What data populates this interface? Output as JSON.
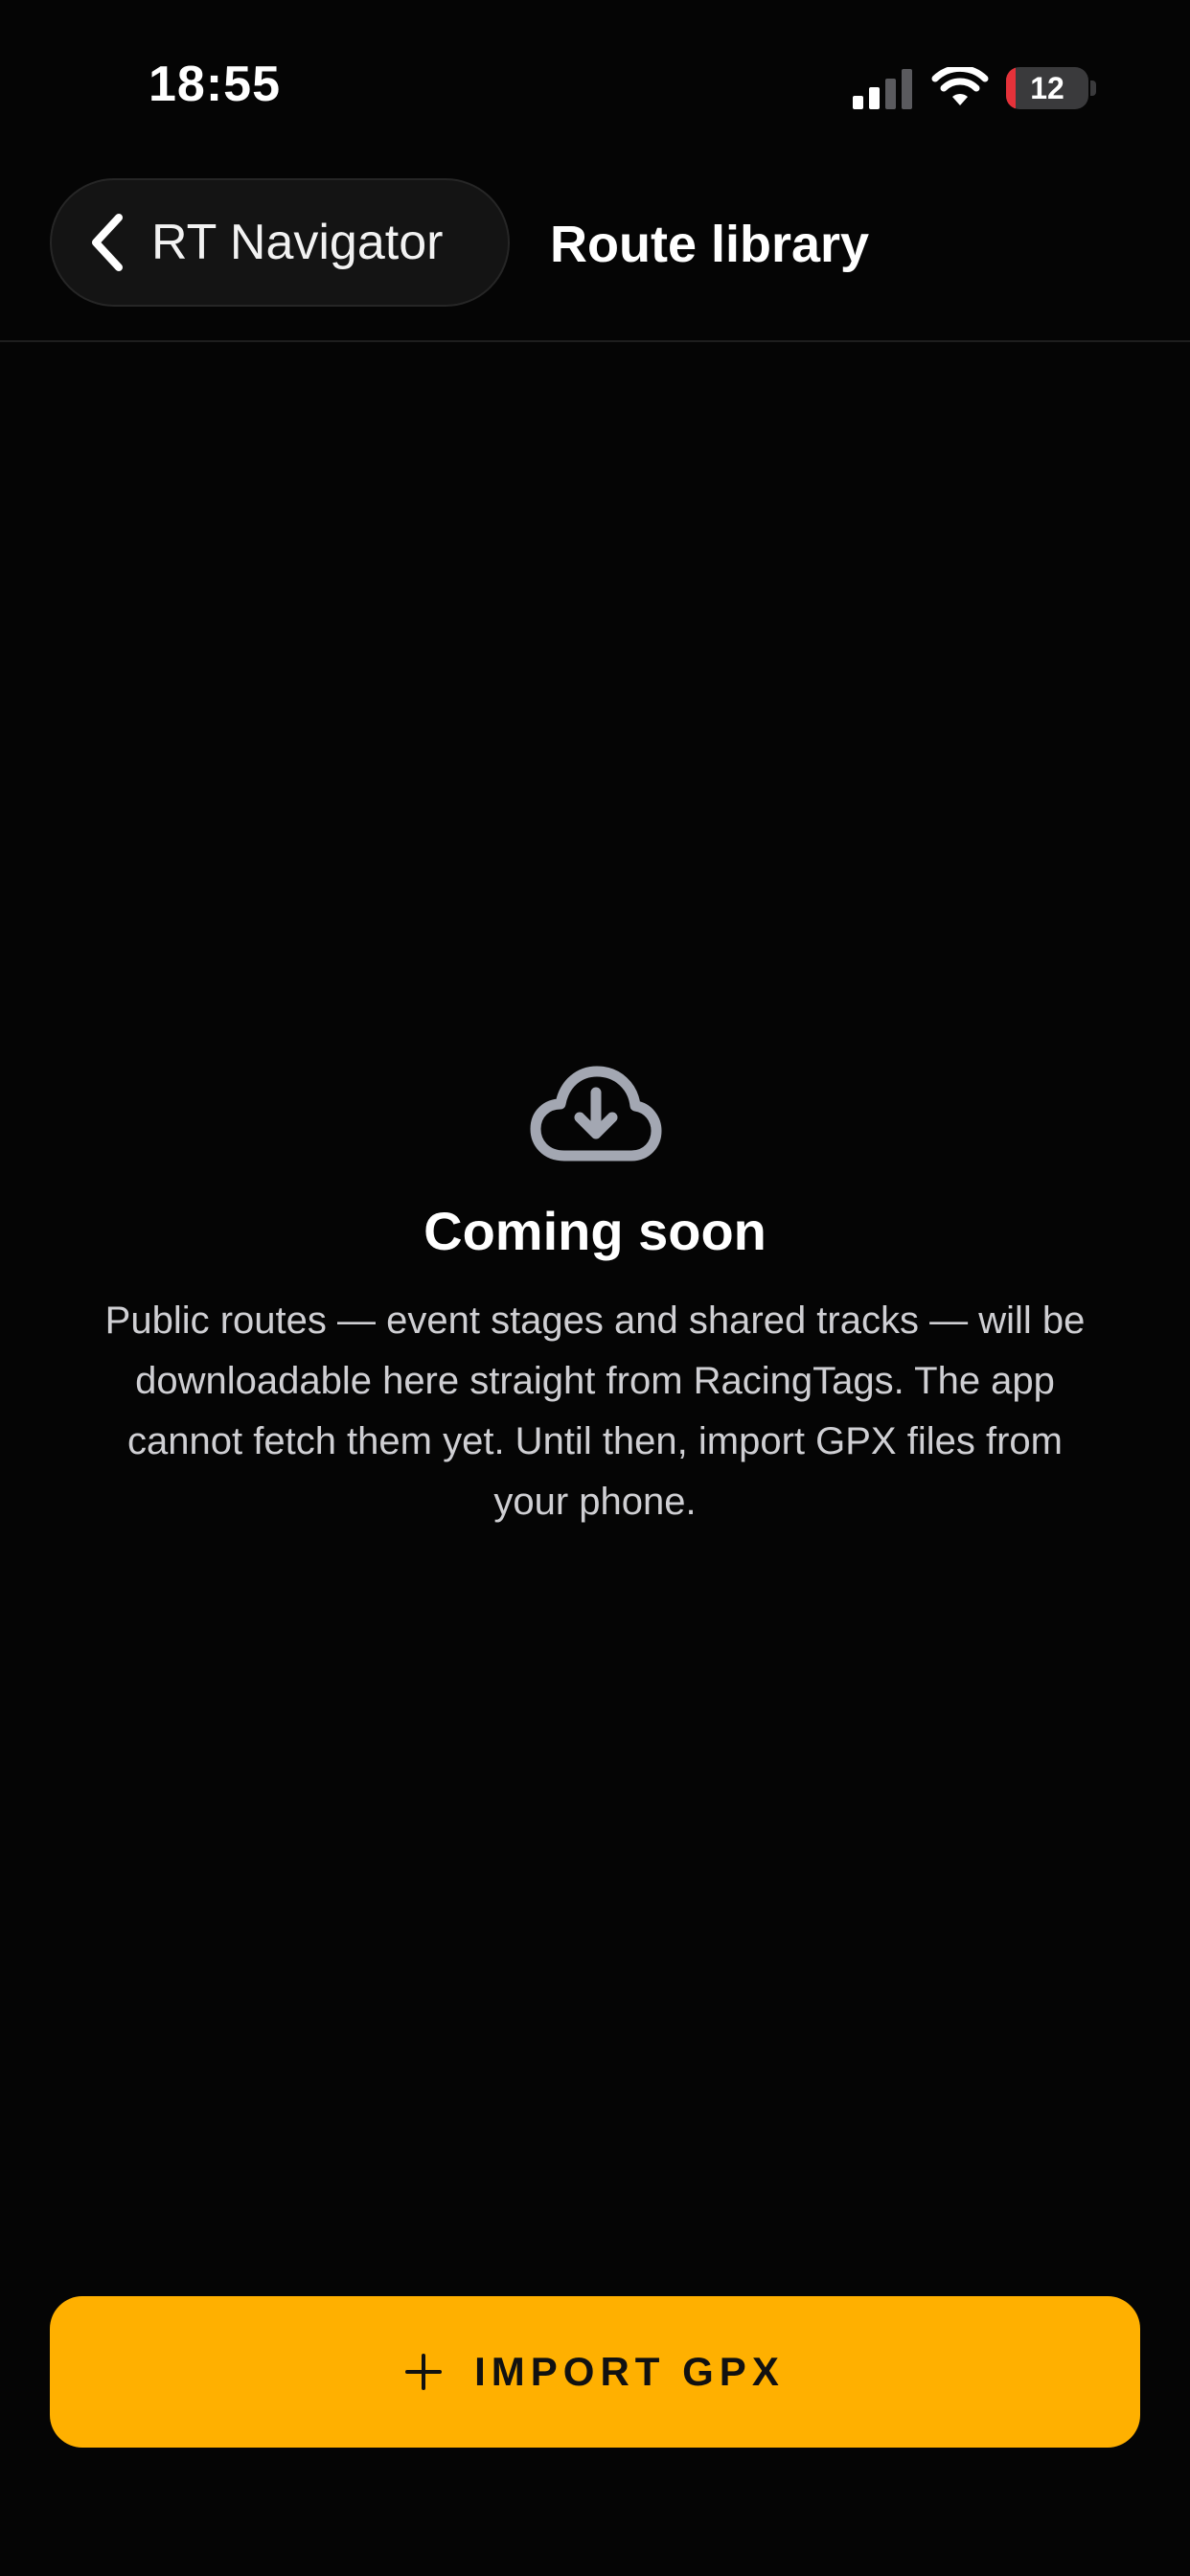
{
  "status_bar": {
    "time": "18:55",
    "battery_level": "12",
    "battery_fraction": 0.12
  },
  "nav": {
    "back_label": "RT Navigator",
    "title": "Route library"
  },
  "empty_state": {
    "icon": "cloud-download-icon",
    "title": "Coming soon",
    "description": "Public routes — event stages and shared tracks — will be downloadable here straight from RacingTags. The app cannot fetch them yet. Until then, import GPX files from your phone."
  },
  "import_button": {
    "label": "IMPORT GPX",
    "icon": "plus-icon"
  },
  "colors": {
    "background": "#050505",
    "accent": "#ffb000",
    "battery_low": "#e5323a"
  }
}
